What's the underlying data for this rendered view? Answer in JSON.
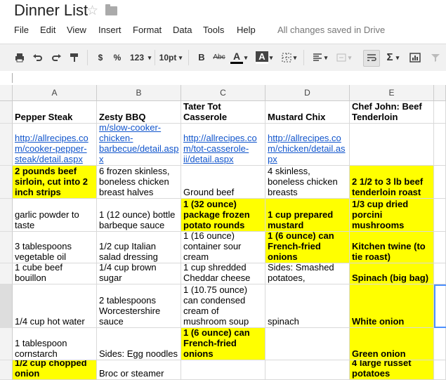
{
  "title": "Dinner List",
  "menu": [
    "File",
    "Edit",
    "View",
    "Insert",
    "Format",
    "Data",
    "Tools",
    "Help"
  ],
  "saved_status": "All changes saved in Drive",
  "toolbar": {
    "currency": "$",
    "percent": "%",
    "number_format": "123",
    "font_size": "10pt",
    "bold": "B",
    "strike": "Abc",
    "text_color": "A",
    "fill_color": "A",
    "sum": "Σ"
  },
  "columns": [
    "A",
    "B",
    "C",
    "D",
    "E"
  ],
  "rows": [
    [
      "Pepper Steak",
      "Zesty BBQ",
      "Tater Tot Casserole",
      "Mustard Chix",
      "Chef John: Beef Tenderloin"
    ],
    [
      "http://allrecipes.com/cooker-pepper-steak/detail.aspx",
      "http://allrecipes.com/slow-cooker-chicken-barbecue/detail.aspx",
      "http://allrecipes.com/tot-casserole-ii/detail.aspx",
      "http://allrecipes.com/chicken/detail.aspx",
      ""
    ],
    [
      "2 pounds beef sirloin, cut into 2 inch strips",
      "6 frozen skinless, boneless chicken breast halves",
      "Ground beef",
      "4 skinless, boneless chicken breasts",
      "2 1/2 to 3 lb beef tenderloin roast"
    ],
    [
      "garlic powder to taste",
      "1 (12 ounce) bottle barbeque sauce",
      "1 (32 ounce) package frozen potato rounds",
      "1 cup prepared mustard",
      "1/3 cup dried porcini mushrooms"
    ],
    [
      "3 tablespoons vegetable oil",
      "1/2 cup Italian salad dressing",
      "1 (16 ounce) container sour cream",
      "1 (6 ounce) can French-fried onions",
      "Kitchen twine (to tie roast)"
    ],
    [
      "1 cube beef bouillon",
      "1/4 cup brown sugar",
      "1 cup shredded Cheddar cheese",
      "Sides: Smashed potatoes,",
      "Spinach (big bag)"
    ],
    [
      "1/4 cup hot water",
      "2 tablespoons Worcestershire sauce",
      "1 (10.75 ounce) can condensed cream of mushroom soup",
      "spinach",
      "White onion"
    ],
    [
      "1 tablespoon cornstarch",
      "Sides: Egg noodles",
      "1 (6 ounce) can French-fried onions",
      "",
      "Green onion"
    ],
    [
      "1/2 cup chopped onion",
      "Broc or steamer",
      "",
      "",
      "4 large russet potatoes"
    ]
  ]
}
